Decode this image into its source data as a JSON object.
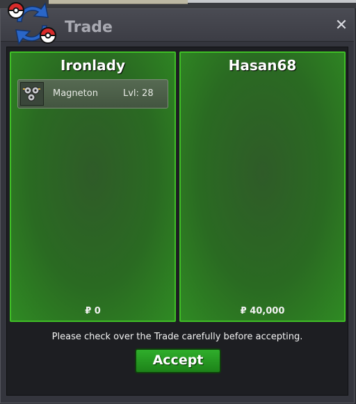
{
  "window": {
    "title": "Trade"
  },
  "trade": {
    "left": {
      "player": "Ironlady",
      "items": [
        {
          "name": "Magneton",
          "level": "Lvl: 28",
          "icon": "magneton-icon"
        }
      ],
      "money": "₽ 0"
    },
    "right": {
      "player": "Hasan68",
      "items": [],
      "money": "₽ 40,000"
    }
  },
  "footer": {
    "note": "Please check over the Trade carefully before accepting.",
    "accept_label": "Accept"
  },
  "colors": {
    "panel_border": "#3fbf26",
    "accept_button": "#2fae2b",
    "window_bg": "#34353d"
  }
}
